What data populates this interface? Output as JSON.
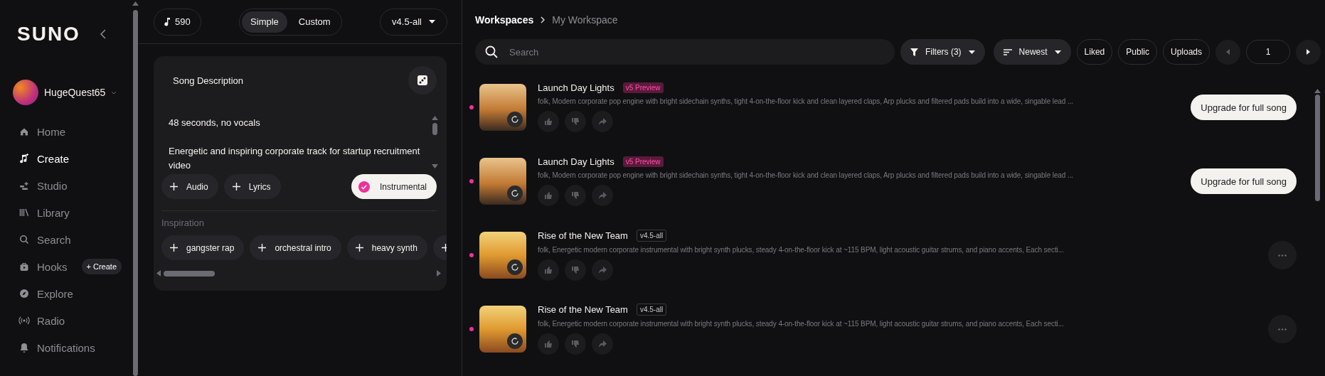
{
  "sidebar": {
    "logo": "SUNO",
    "user": {
      "name": "HugeQuest65"
    },
    "nav": [
      {
        "label": "Home",
        "selected": false
      },
      {
        "label": "Create",
        "selected": true
      },
      {
        "label": "Studio",
        "selected": false
      },
      {
        "label": "Library",
        "selected": false
      },
      {
        "label": "Search",
        "selected": false
      },
      {
        "label": "Hooks",
        "selected": false,
        "badge": "+ Create"
      },
      {
        "label": "Explore",
        "selected": false
      },
      {
        "label": "Radio",
        "selected": false
      },
      {
        "label": "Notifications",
        "selected": false
      }
    ]
  },
  "create_panel": {
    "credits": "590",
    "modes": [
      {
        "label": "Simple",
        "selected": true
      },
      {
        "label": "Custom",
        "selected": false
      }
    ],
    "model": "v4.5-all",
    "card": {
      "title": "Song Description",
      "description": [
        "48 seconds, no vocals",
        "Energetic and inspiring corporate track for startup recruitment video"
      ],
      "options": [
        {
          "label": "Audio"
        },
        {
          "label": "Lyrics"
        }
      ],
      "instrumental": {
        "label": "Instrumental",
        "checked": true
      },
      "inspiration_title": "Inspiration",
      "inspiration": [
        "gangster rap",
        "orchestral intro",
        "heavy synth"
      ]
    }
  },
  "workspace": {
    "breadcrumb": [
      "Workspaces",
      "My Workspace"
    ],
    "search": {
      "placeholder": "Search"
    },
    "filters": "Filters (3)",
    "sort": "Newest",
    "toggles": [
      "Liked",
      "Public",
      "Uploads"
    ],
    "page": "1",
    "songs": [
      {
        "title": "Launch Day Lights",
        "badge": {
          "label": "v5 Preview",
          "kind": "preview"
        },
        "description": "folk, Modern corporate pop engine with bright sidechain synths, tight 4-on-the-floor kick and clean layered claps, Arp plucks and filtered pads build into a wide, singable lead ...",
        "action": {
          "kind": "upgrade",
          "label": "Upgrade for full song"
        }
      },
      {
        "title": "Launch Day Lights",
        "badge": {
          "label": "v5 Preview",
          "kind": "preview"
        },
        "description": "folk, Modern corporate pop engine with bright sidechain synths, tight 4-on-the-floor kick and clean layered claps, Arp plucks and filtered pads build into a wide, singable lead ...",
        "action": {
          "kind": "upgrade",
          "label": "Upgrade for full song"
        }
      },
      {
        "title": "Rise of the New Team",
        "badge": {
          "label": "v4.5-all",
          "kind": "plain"
        },
        "description": "folk, Energetic modern corporate instrumental with bright synth plucks, steady 4-on-the-floor kick at ~115 BPM, light acoustic guitar strums, and piano accents, Each secti...",
        "action": {
          "kind": "more"
        }
      },
      {
        "title": "Rise of the New Team",
        "badge": {
          "label": "v4.5-all",
          "kind": "plain"
        },
        "description": "folk, Energetic modern corporate instrumental with bright synth plucks, steady 4-on-the-floor kick at ~115 BPM, light acoustic guitar strums, and piano accents, Each secti...",
        "action": {
          "kind": "more"
        }
      }
    ]
  }
}
